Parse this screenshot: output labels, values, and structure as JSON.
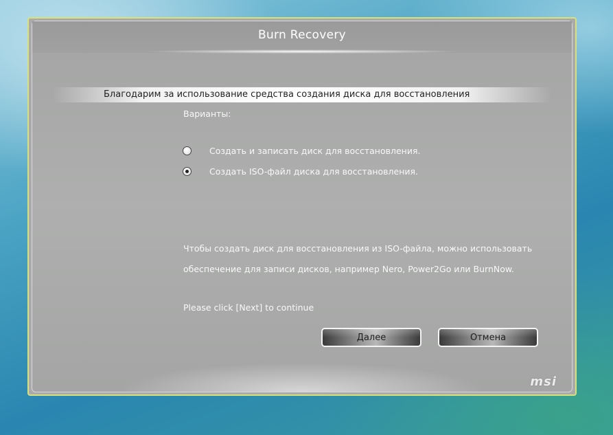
{
  "window": {
    "title": "Burn Recovery"
  },
  "banner": {
    "text": "Благодарим за использование средства создания диска для восстановления"
  },
  "options": {
    "label": "Варианты:",
    "items": [
      {
        "label": "Создать и записать диск для восстановления.",
        "selected": false
      },
      {
        "label": "Создать ISO-файл диска для восстановления.",
        "selected": true
      }
    ]
  },
  "info": {
    "line1": "Чтобы создать диск для восстановления из ISO-файла, можно использовать",
    "line2": "обеспечение для записи дисков, например Nero, Power2Go или BurnNow.",
    "prompt": "Please click [Next] to continue"
  },
  "buttons": {
    "next": "Далее",
    "cancel": "Отмена"
  },
  "brand": {
    "logo": "msi"
  },
  "colors": {
    "frame_border": "#d8e27a",
    "panel": "#a9aaa9",
    "text_light": "#f8f8f8"
  }
}
